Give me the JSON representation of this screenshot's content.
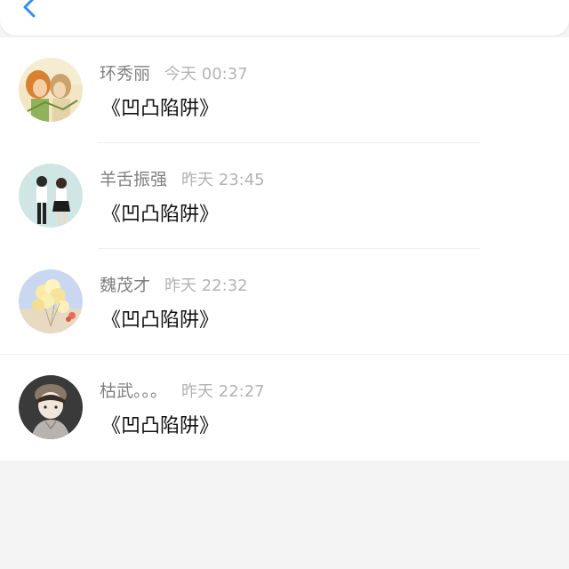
{
  "header": {
    "back_icon": "chevron-left-icon",
    "accent_color": "#2f8ef4"
  },
  "comments": [
    {
      "name": "环秀丽",
      "time": "今天 00:37",
      "message": "《凹凸陷阱》",
      "avatar": "anime-couple-drawing-avatar"
    },
    {
      "name": "羊舌振强",
      "time": "昨天 23:45",
      "message": "《凹凸陷阱》",
      "avatar": "couple-photo-avatar"
    },
    {
      "name": "魏茂才",
      "time": "昨天 22:32",
      "message": "《凹凸陷阱》",
      "avatar": "balloons-avatar"
    },
    {
      "name": "枯武。。。",
      "time": "昨天 22:27",
      "message": "《凹凸陷阱》",
      "avatar": "anime-boy-hoodie-avatar"
    }
  ]
}
